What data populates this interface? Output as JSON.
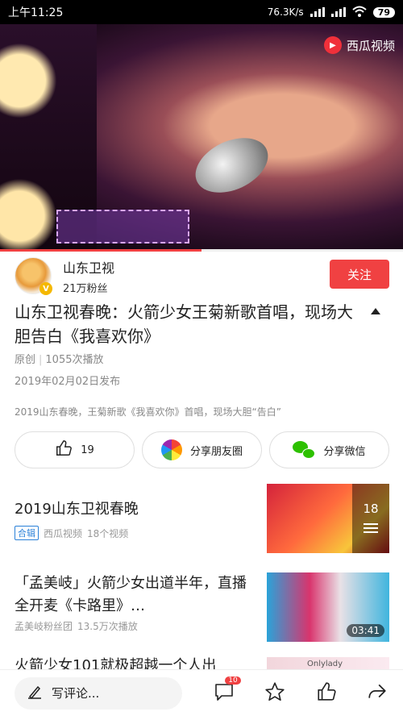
{
  "status_bar": {
    "time": "上午11:25",
    "network_speed": "76.3K/s",
    "battery": "79"
  },
  "video": {
    "watermark": "西瓜视频",
    "progress_fraction": 0.5
  },
  "author": {
    "name": "山东卫视",
    "fans": "21万粉丝",
    "follow_label": "关注"
  },
  "article": {
    "title": "山东卫视春晚：火箭少女王菊新歌首唱，现场大胆告白《我喜欢你》",
    "original": "原创",
    "plays": "1055次播放",
    "publish_date": "2019年02月02日发布",
    "description": "2019山东春晚，王菊新歌《我喜欢你》首唱，现场大胆“告白”"
  },
  "actions": {
    "like_count": "19",
    "share_moments": "分享朋友圈",
    "share_wechat": "分享微信"
  },
  "related": [
    {
      "title": "2019山东卫视春晚",
      "tag": "合辑",
      "source": "西瓜视频",
      "count": "18个视频",
      "thumb_count": "18"
    },
    {
      "title": "「孟美岐」火箭少女出道半年，直播全开麦《卡路里》…",
      "author": "孟美岐粉丝团",
      "plays": "13.5万次播放",
      "duration": "03:41"
    },
    {
      "title": "火箭少女101就极超越一个人出",
      "thumb_text": "Onlylady"
    }
  ],
  "bottom_bar": {
    "comment_placeholder": "写评论...",
    "comment_badge": "10"
  },
  "icons": [
    "pen-icon",
    "comment-icon",
    "star-icon",
    "thumbs-up-icon",
    "share-icon",
    "moments-icon",
    "wechat-icon",
    "xigua-play-icon",
    "wifi-icon",
    "signal-icon",
    "battery-icon",
    "collapse-arrow-icon",
    "playlist-icon"
  ]
}
